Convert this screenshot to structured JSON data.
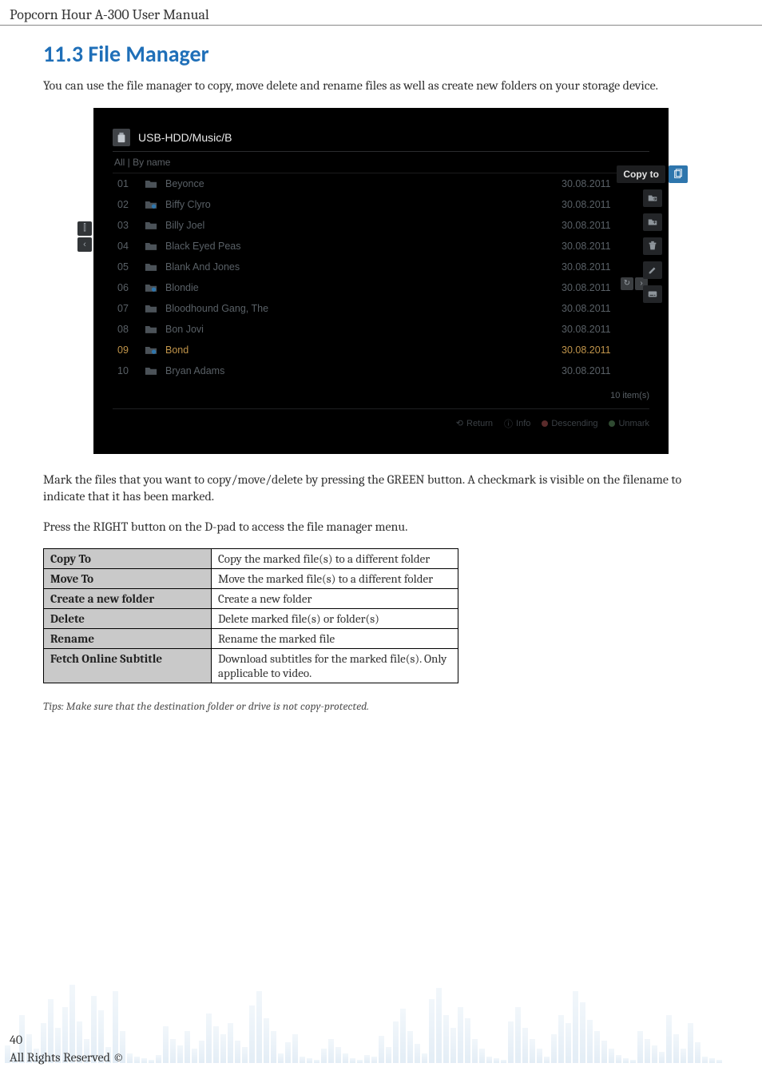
{
  "page_header": "Popcorn Hour A-300 User Manual",
  "section_heading": "11.3 File Manager",
  "intro_paragraph": "You can use the file manager to copy, move delete and rename files as well as create new folders on your storage device.",
  "para_mark": "Mark the files that you want to copy/move/delete by pressing the GREEN button. A checkmark is visible on the filename to indicate that it has been marked.",
  "para_press": "Press the RIGHT button on the D-pad to access the file manager menu.",
  "tip": "Tips: Make sure that the destination folder or drive is not copy-protected.",
  "screenshot": {
    "path": "USB-HDD/Music/B",
    "filter_label": "All | By name",
    "tooltip": "Copy to",
    "rows": [
      {
        "num": "01",
        "name": "Beyonce",
        "date": "30.08.2011",
        "marked": false,
        "badge": false
      },
      {
        "num": "02",
        "name": "Biffy Clyro",
        "date": "30.08.2011",
        "marked": false,
        "badge": true
      },
      {
        "num": "03",
        "name": "Billy Joel",
        "date": "30.08.2011",
        "marked": false,
        "badge": false
      },
      {
        "num": "04",
        "name": "Black Eyed Peas",
        "date": "30.08.2011",
        "marked": false,
        "badge": false
      },
      {
        "num": "05",
        "name": "Blank And Jones",
        "date": "30.08.2011",
        "marked": false,
        "badge": false
      },
      {
        "num": "06",
        "name": "Blondie",
        "date": "30.08.2011",
        "marked": false,
        "badge": true
      },
      {
        "num": "07",
        "name": "Bloodhound Gang, The",
        "date": "30.08.2011",
        "marked": false,
        "badge": false
      },
      {
        "num": "08",
        "name": "Bon Jovi",
        "date": "30.08.2011",
        "marked": false,
        "badge": false
      },
      {
        "num": "09",
        "name": "Bond",
        "date": "30.08.2011",
        "marked": true,
        "badge": true
      },
      {
        "num": "10",
        "name": "Bryan Adams",
        "date": "30.08.2011",
        "marked": false,
        "badge": false
      }
    ],
    "footer_count": "10 item(s)",
    "footer_hints": {
      "return": "Return",
      "info": "Info",
      "descending": "Descending",
      "unmark": "Unmark"
    },
    "side_left": {
      "top": "⫿",
      "bottom": "‹"
    },
    "refresh": {
      "l": "↻",
      "r": "›"
    }
  },
  "actions": [
    {
      "label": "Copy To",
      "desc": "Copy the marked file(s) to a different folder"
    },
    {
      "label": "Move To",
      "desc": "Move the marked file(s) to a different folder"
    },
    {
      "label": "Create a new folder",
      "desc": "Create a new folder"
    },
    {
      "label": "Delete",
      "desc": "Delete marked file(s) or folder(s)"
    },
    {
      "label": "Rename",
      "desc": "Rename the marked file"
    },
    {
      "label": "Fetch Online Subtitle",
      "desc": "Download subtitles for the marked file(s). Only applicable to video."
    }
  ],
  "page_number": "40",
  "copyright": "All Rights Reserved ©",
  "eq_bars": [
    22,
    14,
    60,
    36,
    18,
    50,
    80,
    44,
    70,
    98,
    52,
    30,
    84,
    66,
    20,
    90,
    40,
    12,
    8,
    6,
    4,
    10,
    46,
    30,
    22,
    40,
    18,
    28,
    62,
    46,
    36,
    50,
    28,
    20,
    72,
    90,
    56,
    40,
    12,
    26,
    36,
    8,
    6,
    4,
    18,
    30,
    20,
    12,
    6,
    4,
    10,
    8,
    34,
    20,
    52,
    68,
    40,
    24,
    12,
    80,
    94,
    60,
    44,
    70,
    56,
    30,
    18,
    8,
    6,
    4,
    52,
    70,
    44,
    30,
    18,
    8,
    36,
    60,
    50,
    90,
    76,
    54,
    40,
    28,
    18,
    10,
    6,
    4,
    40,
    30,
    22,
    14,
    60,
    36,
    18,
    50,
    26,
    8,
    6,
    4
  ]
}
